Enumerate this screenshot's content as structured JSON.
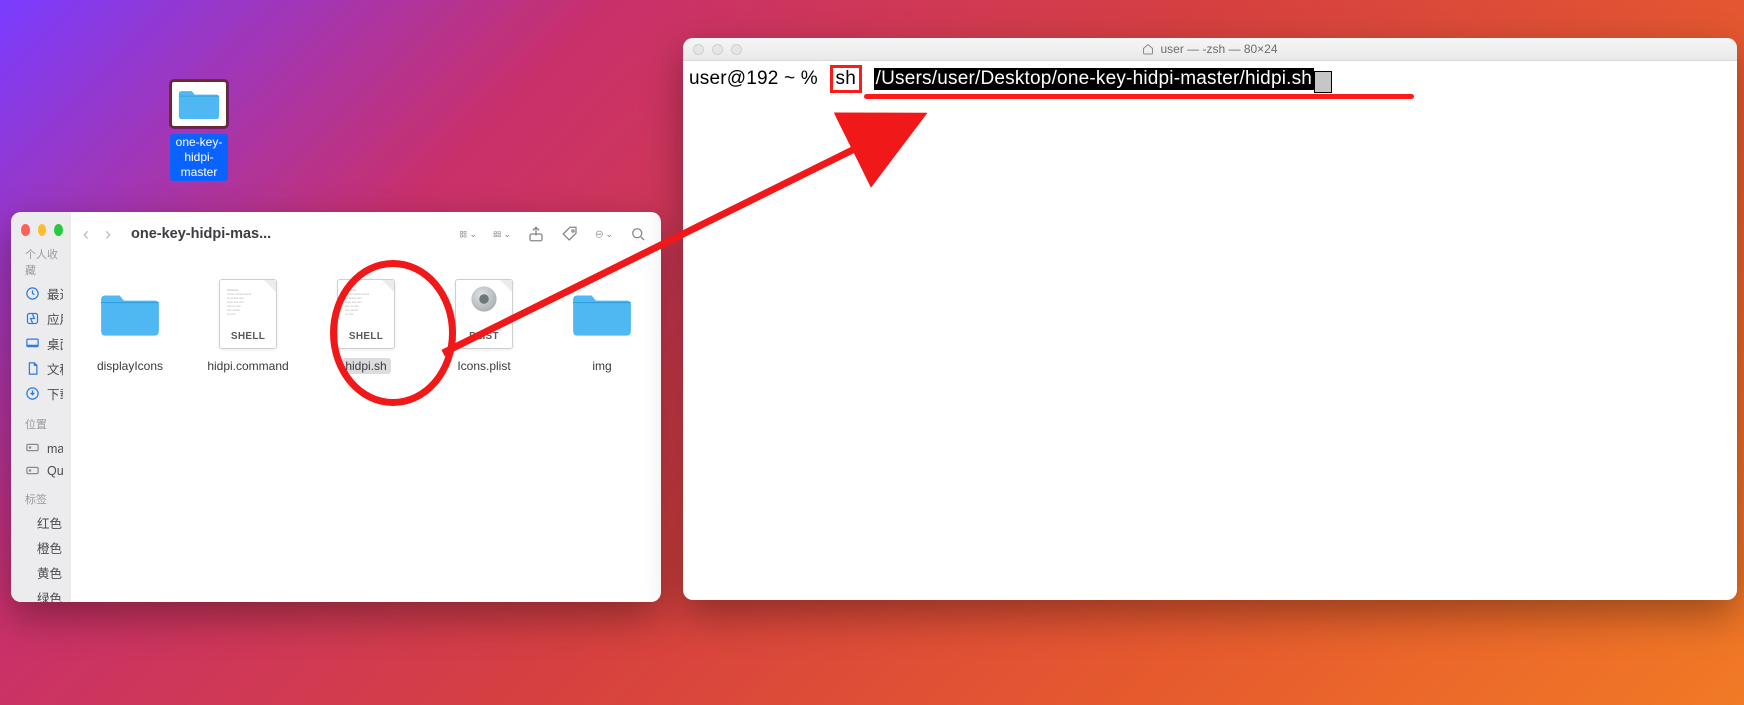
{
  "desktop": {
    "folder_name": "one-key-hidpi-master"
  },
  "finder": {
    "title": "one-key-hidpi-mas...",
    "sidebar": {
      "favorites_header": "个人收藏",
      "recents": "最近项目",
      "apps": "应用程序",
      "desktop": "桌面",
      "documents": "文稿",
      "downloads": "下载",
      "locations_header": "位置",
      "macdata": "mac 数据",
      "quick": "Quick...",
      "tags_header": "标签",
      "tag_red": "红色",
      "tag_orange": "橙色",
      "tag_yellow": "黄色",
      "tag_green": "绿色"
    },
    "files": [
      {
        "name": "displayIcons",
        "type": "folder"
      },
      {
        "name": "hidpi.command",
        "type": "shell",
        "badge": "SHELL"
      },
      {
        "name": "hidpi.sh",
        "type": "shell",
        "badge": "SHELL",
        "selected": true
      },
      {
        "name": "Icons.plist",
        "type": "plist",
        "badge": "PLIST"
      },
      {
        "name": "img",
        "type": "folder"
      }
    ]
  },
  "terminal": {
    "title": "user — -zsh — 80×24",
    "prompt": "user@192 ~ %",
    "command_sh": "sh",
    "command_path": "/Users/user/Desktop/one-key-hidpi-master/hidpi.sh"
  },
  "colors": {
    "annotation": "#f01818",
    "folder_blue": "#4fb8f3",
    "selection_blue": "#0a63ff"
  }
}
